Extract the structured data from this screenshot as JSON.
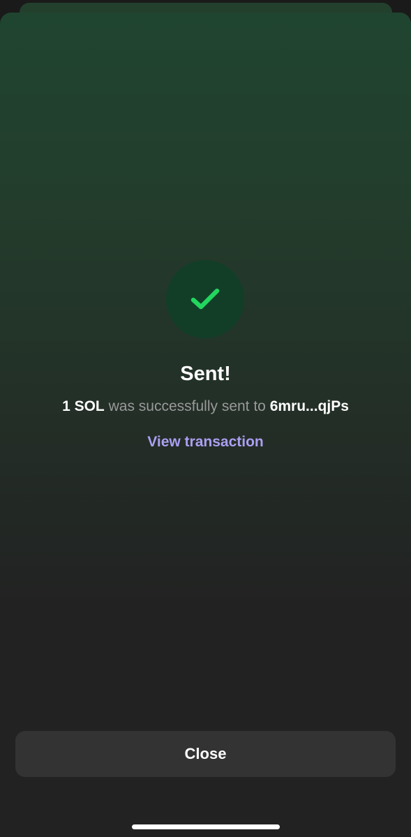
{
  "success": {
    "icon": "checkmark-icon",
    "title": "Sent!",
    "amount": "1 SOL",
    "message": " was successfully sent to ",
    "recipient": "6mru...qjPs",
    "view_link": "View transaction"
  },
  "footer": {
    "close_label": "Close"
  },
  "colors": {
    "accent_link": "#ab9ff2",
    "check_green": "#22d65e",
    "circle_bg": "#123e28",
    "button_bg": "#333333",
    "background": "#222222"
  }
}
